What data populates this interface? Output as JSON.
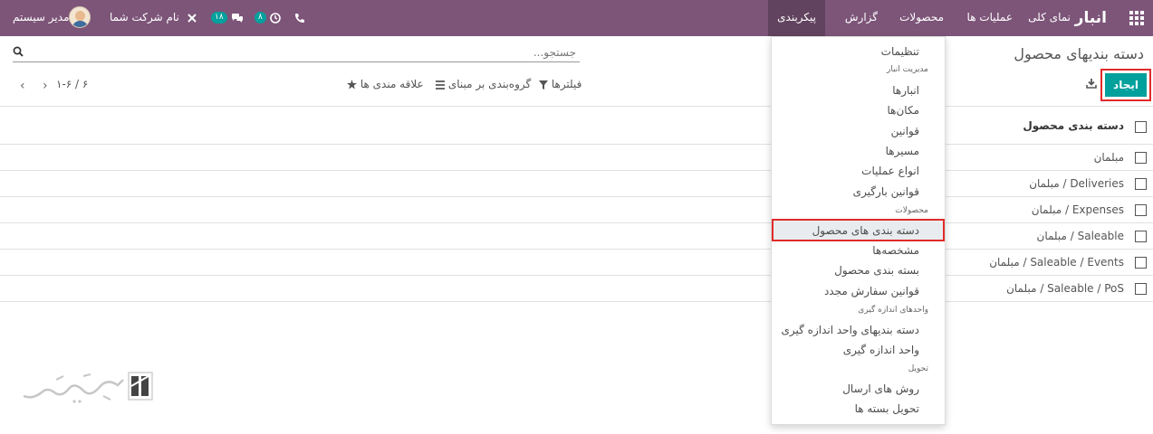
{
  "navbar": {
    "app_title": "انبار",
    "menu": [
      "نمای کلی",
      "عملیات ها",
      "محصولات",
      "گزارش",
      "پیکربندی"
    ],
    "active_menu": "پیکربندی",
    "user_name": "مدیر سیستم",
    "company_name": "نام شرکت شما",
    "messages_count": "۱۸",
    "activities_count": "۸",
    "bg_color": "#7d5579"
  },
  "control_panel": {
    "breadcrumb": "دسته بندیهای محصول",
    "create_label": "ایجاد",
    "search_placeholder": "جستجو...",
    "filters_label": "فیلترها",
    "group_by_label": "گروه‌بندی بر مبنای",
    "favorites_label": "علاقه مندی ها",
    "pager": "۱-۶ / ۶"
  },
  "list": {
    "header": "دسته بندی محصول",
    "rows": [
      "مبلمان",
      "مبلمان / Deliveries",
      "مبلمان / Expenses",
      "مبلمان / Saleable",
      "مبلمان / Saleable / Events",
      "مبلمان / Saleable / PoS"
    ]
  },
  "dropdown": {
    "items": [
      {
        "type": "item",
        "label": "تنظیمات"
      },
      {
        "type": "header",
        "label": "مدیریت انبار"
      },
      {
        "type": "item",
        "label": "انبارها"
      },
      {
        "type": "item",
        "label": "مکان‌ها"
      },
      {
        "type": "item",
        "label": "قوانین"
      },
      {
        "type": "item",
        "label": "مسیرها"
      },
      {
        "type": "item",
        "label": "انواع عملیات"
      },
      {
        "type": "item",
        "label": "قوانین بارگیری"
      },
      {
        "type": "header",
        "label": "محصولات"
      },
      {
        "type": "item",
        "label": "دسته بندی های محصول",
        "selected": true
      },
      {
        "type": "item",
        "label": "مشخصه‌ها"
      },
      {
        "type": "item",
        "label": "بسته بندی محصول"
      },
      {
        "type": "item",
        "label": "قوانین سفارش مجدد"
      },
      {
        "type": "header",
        "label": "واحدهای اندازه گیری"
      },
      {
        "type": "item",
        "label": "دسته بندیهای واحد اندازه گیری"
      },
      {
        "type": "item",
        "label": "واحد اندازه گیری"
      },
      {
        "type": "header",
        "label": "تحویل"
      },
      {
        "type": "item",
        "label": "روش های ارسال"
      },
      {
        "type": "item",
        "label": "تحویل بسته ها"
      }
    ]
  },
  "colors": {
    "accent": "#00a09d",
    "highlight_border": "#e12a2a"
  }
}
